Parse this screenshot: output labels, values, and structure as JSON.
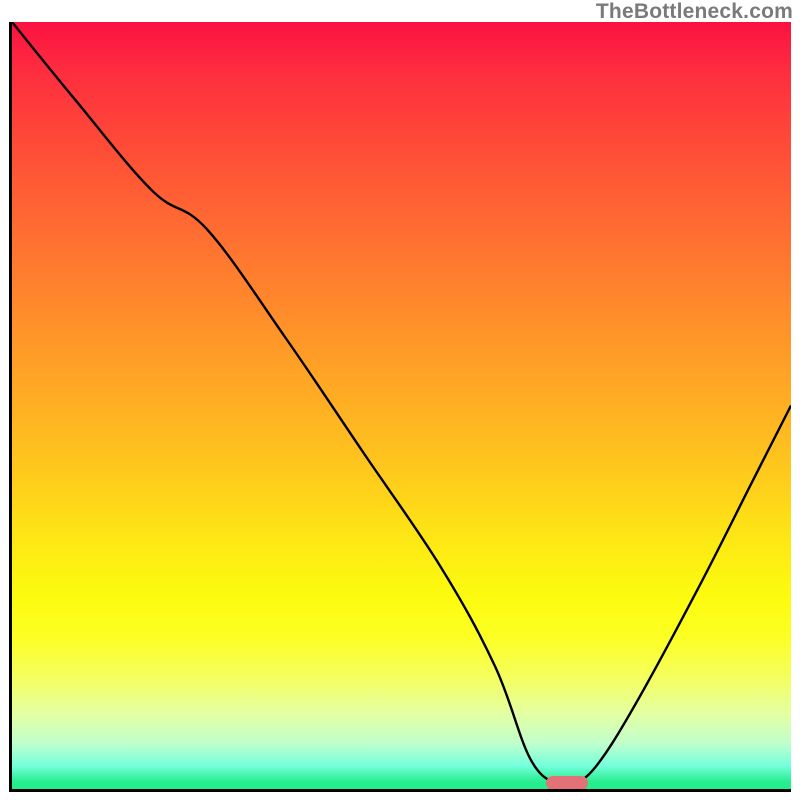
{
  "watermark": "TheBottleneck.com",
  "chart_data": {
    "type": "line",
    "title": "",
    "xlabel": "",
    "ylabel": "",
    "xlim": [
      0,
      100
    ],
    "ylim": [
      0,
      100
    ],
    "series": [
      {
        "name": "bottleneck-curve",
        "x": [
          0,
          8,
          18,
          25,
          35,
          45,
          55,
          62,
          66.5,
          70,
          72,
          75,
          80,
          88,
          95,
          100
        ],
        "values": [
          100,
          90,
          78,
          73,
          59,
          44,
          29,
          16,
          4,
          0.6,
          0.6,
          3,
          11,
          26,
          40,
          50
        ]
      }
    ],
    "marker": {
      "x_start": 68.5,
      "x_end": 74,
      "y": 0.8,
      "color": "#e27277"
    },
    "background_gradient": {
      "stops": [
        {
          "pos": 0,
          "color": "#fb1141"
        },
        {
          "pos": 18,
          "color": "#ff5136"
        },
        {
          "pos": 45,
          "color": "#ffa126"
        },
        {
          "pos": 68,
          "color": "#fde914"
        },
        {
          "pos": 85,
          "color": "#f6ff59"
        },
        {
          "pos": 97,
          "color": "#74ffdd"
        },
        {
          "pos": 100,
          "color": "#23ee8c"
        }
      ]
    }
  }
}
